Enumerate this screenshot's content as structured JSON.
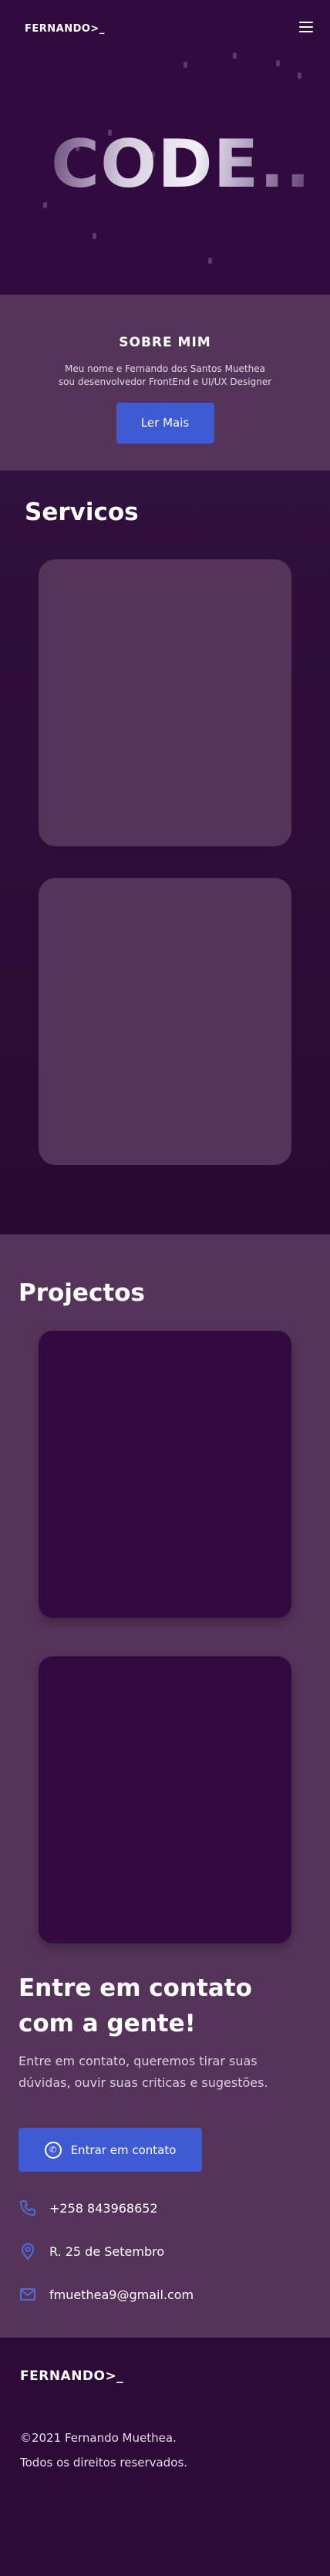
{
  "header": {
    "logo": "FERNANDO>_"
  },
  "hero": {
    "word": "CODE.."
  },
  "about": {
    "title": "SOBRE MIM",
    "line1": "Meu nome e Fernando dos Santos Muethea",
    "line2": "sou desenvolvedor FrontEnd e UI/UX Designer",
    "button": "Ler Mais"
  },
  "services": {
    "title": "Servicos"
  },
  "projects": {
    "title": "Projectos"
  },
  "contact": {
    "title_line1": "Entre em contato",
    "title_line2": "com a gente!",
    "desc_line1": "Entre em contato, queremos tirar suas",
    "desc_line2": "dúvidas, ouvir suas criticas e sugestões.",
    "button": "Entrar em contato",
    "phone": "+258 843968652",
    "address": "R. 25 de Setembro",
    "email": "fmuethea9@gmail.com"
  },
  "footer": {
    "logo": "FERNANDO>_",
    "copyright": "©2021 Fernando Muethea.",
    "rights": "Todos os direitos reservados."
  },
  "colors": {
    "accent_blue": "#3e5bd3",
    "purple_dark": "#2c0b35",
    "purple_mid": "#553459"
  },
  "icons": {
    "menu": "hamburger-icon",
    "whatsapp": "whatsapp-icon",
    "phone": "phone-icon",
    "location": "location-pin-icon",
    "email": "mail-icon"
  }
}
